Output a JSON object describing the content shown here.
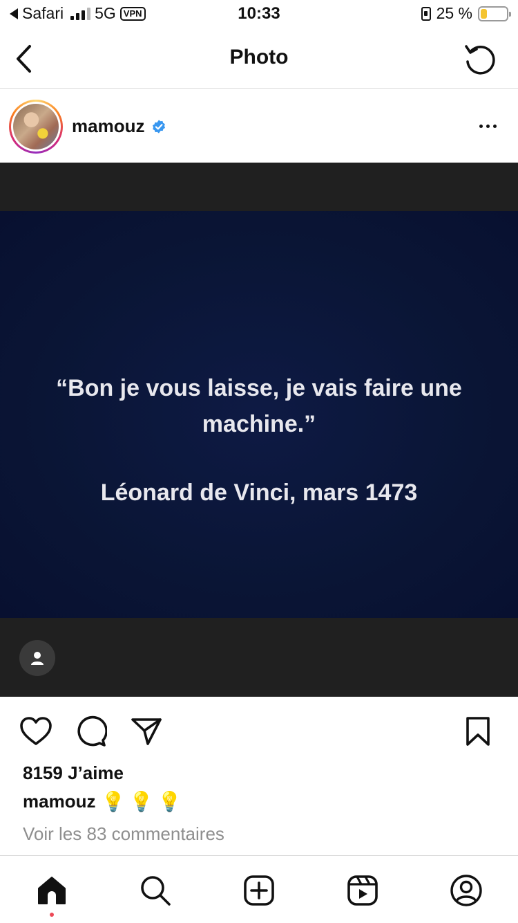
{
  "status_bar": {
    "back_app": "Safari",
    "network": "5G",
    "vpn": "VPN",
    "time": "10:33",
    "battery_percent_text": "25 %",
    "battery_level": 0.25,
    "battery_color": "#f4c430"
  },
  "nav": {
    "title": "Photo",
    "back_icon": "chevron-left-icon",
    "refresh_icon": "refresh-icon"
  },
  "post": {
    "username": "mamouz",
    "verified": true,
    "verified_color": "#3897f0",
    "image_quote": "“Bon je vous laisse, je vais faire une machine.”",
    "image_attribution": "Léonard de Vinci, mars 1473",
    "likes": "8159 J’aime",
    "caption_user": "mamouz",
    "caption_text": "💡💡💡",
    "view_comments": "Voir les 83 commentaires"
  },
  "actions": {
    "like_icon": "heart-icon",
    "comment_icon": "comment-icon",
    "share_icon": "send-icon",
    "save_icon": "bookmark-icon"
  },
  "tab_bar": {
    "items": [
      {
        "name": "home",
        "icon": "home-icon",
        "active": true
      },
      {
        "name": "search",
        "icon": "search-icon"
      },
      {
        "name": "create",
        "icon": "plus-square-icon"
      },
      {
        "name": "reels",
        "icon": "reels-icon"
      },
      {
        "name": "profile",
        "icon": "profile-icon"
      }
    ],
    "notification_dot_color": "#ed4956"
  }
}
